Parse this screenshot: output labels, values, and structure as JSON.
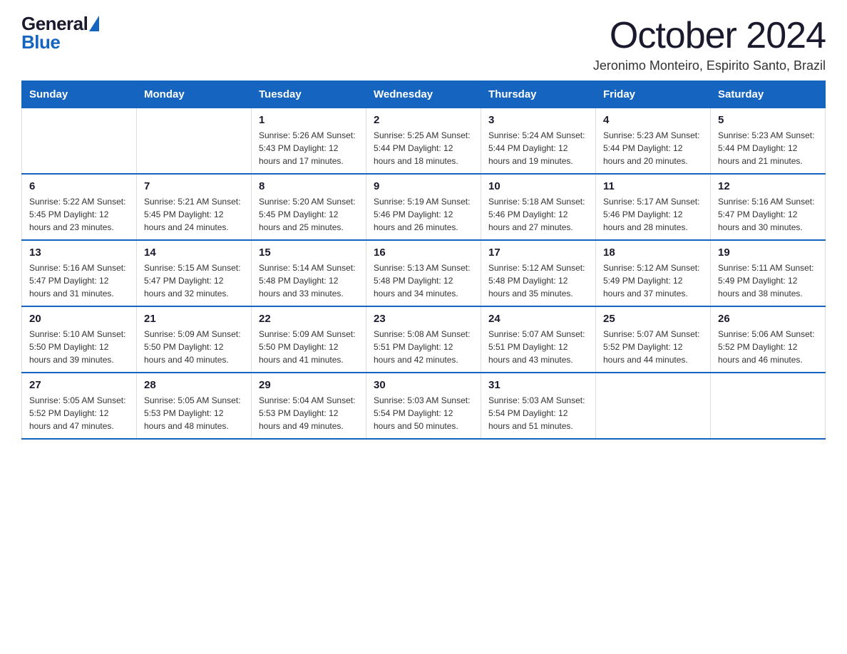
{
  "logo": {
    "general": "General",
    "blue": "Blue"
  },
  "title": {
    "month_year": "October 2024",
    "location": "Jeronimo Monteiro, Espirito Santo, Brazil"
  },
  "headers": [
    "Sunday",
    "Monday",
    "Tuesday",
    "Wednesday",
    "Thursday",
    "Friday",
    "Saturday"
  ],
  "weeks": [
    [
      {
        "day": "",
        "detail": ""
      },
      {
        "day": "",
        "detail": ""
      },
      {
        "day": "1",
        "detail": "Sunrise: 5:26 AM\nSunset: 5:43 PM\nDaylight: 12 hours\nand 17 minutes."
      },
      {
        "day": "2",
        "detail": "Sunrise: 5:25 AM\nSunset: 5:44 PM\nDaylight: 12 hours\nand 18 minutes."
      },
      {
        "day": "3",
        "detail": "Sunrise: 5:24 AM\nSunset: 5:44 PM\nDaylight: 12 hours\nand 19 minutes."
      },
      {
        "day": "4",
        "detail": "Sunrise: 5:23 AM\nSunset: 5:44 PM\nDaylight: 12 hours\nand 20 minutes."
      },
      {
        "day": "5",
        "detail": "Sunrise: 5:23 AM\nSunset: 5:44 PM\nDaylight: 12 hours\nand 21 minutes."
      }
    ],
    [
      {
        "day": "6",
        "detail": "Sunrise: 5:22 AM\nSunset: 5:45 PM\nDaylight: 12 hours\nand 23 minutes."
      },
      {
        "day": "7",
        "detail": "Sunrise: 5:21 AM\nSunset: 5:45 PM\nDaylight: 12 hours\nand 24 minutes."
      },
      {
        "day": "8",
        "detail": "Sunrise: 5:20 AM\nSunset: 5:45 PM\nDaylight: 12 hours\nand 25 minutes."
      },
      {
        "day": "9",
        "detail": "Sunrise: 5:19 AM\nSunset: 5:46 PM\nDaylight: 12 hours\nand 26 minutes."
      },
      {
        "day": "10",
        "detail": "Sunrise: 5:18 AM\nSunset: 5:46 PM\nDaylight: 12 hours\nand 27 minutes."
      },
      {
        "day": "11",
        "detail": "Sunrise: 5:17 AM\nSunset: 5:46 PM\nDaylight: 12 hours\nand 28 minutes."
      },
      {
        "day": "12",
        "detail": "Sunrise: 5:16 AM\nSunset: 5:47 PM\nDaylight: 12 hours\nand 30 minutes."
      }
    ],
    [
      {
        "day": "13",
        "detail": "Sunrise: 5:16 AM\nSunset: 5:47 PM\nDaylight: 12 hours\nand 31 minutes."
      },
      {
        "day": "14",
        "detail": "Sunrise: 5:15 AM\nSunset: 5:47 PM\nDaylight: 12 hours\nand 32 minutes."
      },
      {
        "day": "15",
        "detail": "Sunrise: 5:14 AM\nSunset: 5:48 PM\nDaylight: 12 hours\nand 33 minutes."
      },
      {
        "day": "16",
        "detail": "Sunrise: 5:13 AM\nSunset: 5:48 PM\nDaylight: 12 hours\nand 34 minutes."
      },
      {
        "day": "17",
        "detail": "Sunrise: 5:12 AM\nSunset: 5:48 PM\nDaylight: 12 hours\nand 35 minutes."
      },
      {
        "day": "18",
        "detail": "Sunrise: 5:12 AM\nSunset: 5:49 PM\nDaylight: 12 hours\nand 37 minutes."
      },
      {
        "day": "19",
        "detail": "Sunrise: 5:11 AM\nSunset: 5:49 PM\nDaylight: 12 hours\nand 38 minutes."
      }
    ],
    [
      {
        "day": "20",
        "detail": "Sunrise: 5:10 AM\nSunset: 5:50 PM\nDaylight: 12 hours\nand 39 minutes."
      },
      {
        "day": "21",
        "detail": "Sunrise: 5:09 AM\nSunset: 5:50 PM\nDaylight: 12 hours\nand 40 minutes."
      },
      {
        "day": "22",
        "detail": "Sunrise: 5:09 AM\nSunset: 5:50 PM\nDaylight: 12 hours\nand 41 minutes."
      },
      {
        "day": "23",
        "detail": "Sunrise: 5:08 AM\nSunset: 5:51 PM\nDaylight: 12 hours\nand 42 minutes."
      },
      {
        "day": "24",
        "detail": "Sunrise: 5:07 AM\nSunset: 5:51 PM\nDaylight: 12 hours\nand 43 minutes."
      },
      {
        "day": "25",
        "detail": "Sunrise: 5:07 AM\nSunset: 5:52 PM\nDaylight: 12 hours\nand 44 minutes."
      },
      {
        "day": "26",
        "detail": "Sunrise: 5:06 AM\nSunset: 5:52 PM\nDaylight: 12 hours\nand 46 minutes."
      }
    ],
    [
      {
        "day": "27",
        "detail": "Sunrise: 5:05 AM\nSunset: 5:52 PM\nDaylight: 12 hours\nand 47 minutes."
      },
      {
        "day": "28",
        "detail": "Sunrise: 5:05 AM\nSunset: 5:53 PM\nDaylight: 12 hours\nand 48 minutes."
      },
      {
        "day": "29",
        "detail": "Sunrise: 5:04 AM\nSunset: 5:53 PM\nDaylight: 12 hours\nand 49 minutes."
      },
      {
        "day": "30",
        "detail": "Sunrise: 5:03 AM\nSunset: 5:54 PM\nDaylight: 12 hours\nand 50 minutes."
      },
      {
        "day": "31",
        "detail": "Sunrise: 5:03 AM\nSunset: 5:54 PM\nDaylight: 12 hours\nand 51 minutes."
      },
      {
        "day": "",
        "detail": ""
      },
      {
        "day": "",
        "detail": ""
      }
    ]
  ]
}
